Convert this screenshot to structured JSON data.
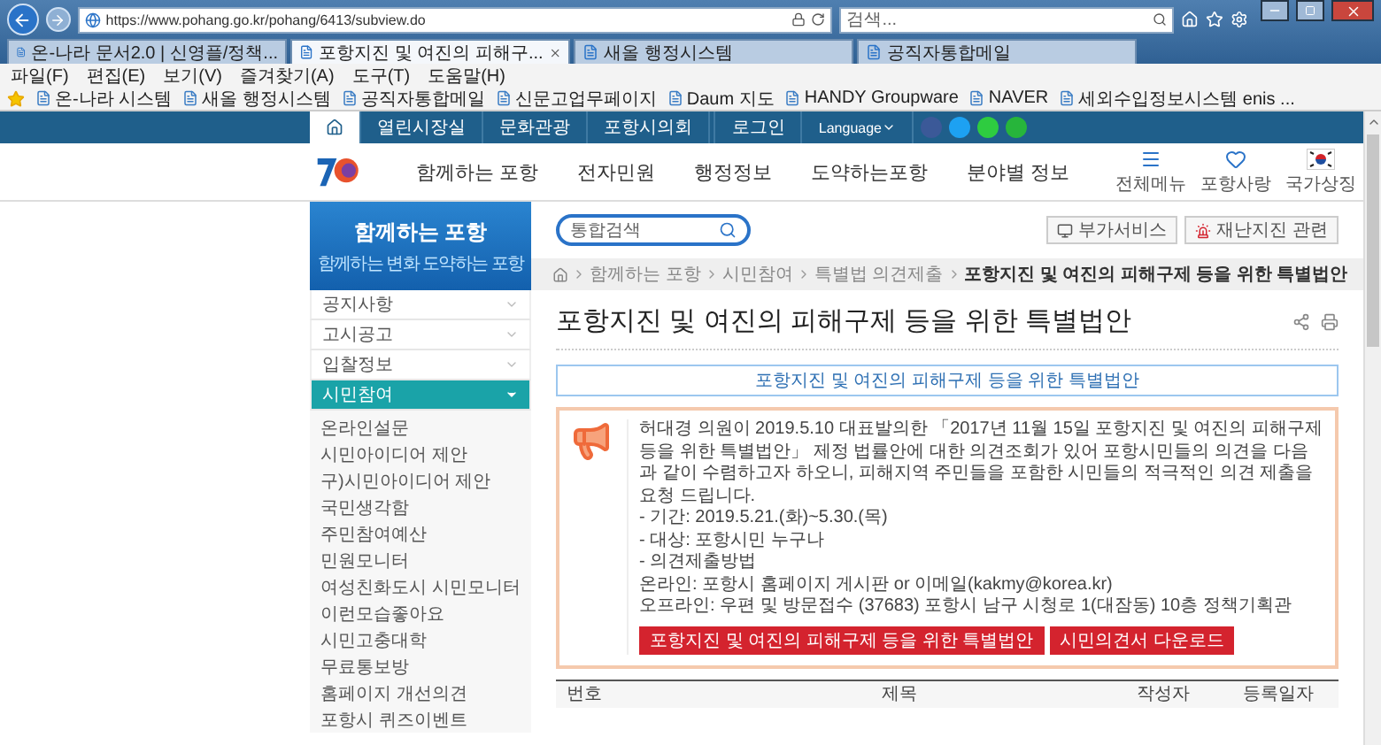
{
  "browser": {
    "address": "https://www.pohang.go.kr/pohang/6413/subview.do",
    "search": {
      "placeholder": "검색..."
    },
    "tabs": [
      {
        "label": "온-나라 문서2.0 | 신영플/정책...",
        "selected": false
      },
      {
        "label": "포항지진 및 여진의 피해구...",
        "selected": true
      },
      {
        "label": "새올 행정시스템",
        "selected": false
      },
      {
        "label": "공직자통합메일",
        "selected": false
      }
    ],
    "menu": [
      "파일(F)",
      "편집(E)",
      "보기(V)",
      "즐겨찾기(A)",
      "도구(T)",
      "도움말(H)"
    ],
    "favorites": [
      "온-나라 시스템",
      "새올 행정시스템",
      "공직자통합메일",
      "신문고업무페이지",
      "Daum 지도",
      "HANDY Groupware",
      "NAVER",
      "세외수입정보시스템 enis ..."
    ]
  },
  "topbar": {
    "items": [
      {
        "kind": "home",
        "selected": true
      },
      {
        "kind": "link",
        "label": "열린시장실",
        "selected": false
      },
      {
        "kind": "link",
        "label": "문화관광",
        "selected": false
      },
      {
        "kind": "link",
        "label": "포항시의회",
        "selected": false
      }
    ],
    "login": "로그인",
    "language": "Language"
  },
  "header": {
    "nav": [
      "함께하는 포항",
      "전자민원",
      "행정정보",
      "도약하는포항",
      "분야별 정보"
    ],
    "tools": [
      "전체메뉴",
      "포항사랑",
      "국가상징"
    ]
  },
  "banner": {
    "title": "함께하는 포항",
    "subtitle": "함께하는 변화 도약하는 포항"
  },
  "search": {
    "placeholder": "통합검색"
  },
  "quick_buttons": [
    "부가서비스",
    "재난지진 관련"
  ],
  "breadcrumb": [
    "함께하는 포항",
    "시민참여",
    "특별법 의견제출",
    "포항지진 및 여진의 피해구제 등을 위한 특별법안"
  ],
  "sidebar": {
    "items": [
      {
        "label": "공지사항",
        "expanded": false
      },
      {
        "label": "고시공고",
        "expanded": false
      },
      {
        "label": "입찰정보",
        "expanded": false
      },
      {
        "label": "시민참여",
        "expanded": true,
        "children": [
          {
            "label": "온라인설문"
          },
          {
            "label": "시민아이디어 제안"
          },
          {
            "label": "구)시민아이디어 제안"
          },
          {
            "label": "국민생각함"
          },
          {
            "label": "주민참여예산"
          },
          {
            "label": "민원모니터"
          },
          {
            "label": "여성친화도시 시민모니터"
          },
          {
            "label": "이런모습좋아요"
          },
          {
            "label": "시민고충대학"
          },
          {
            "label": "무료통보방"
          },
          {
            "label": "홈페이지 개선의견"
          },
          {
            "label": "포항시 퀴즈이벤트"
          }
        ]
      }
    ]
  },
  "content": {
    "title": "포항지진 및 여진의 피해구제 등을 위한 특별법안",
    "link_box": "포항지진 및 여진의 피해구제 등을 위한 특별법안",
    "notice": {
      "paragraph": "허대경 의원이 2019.5.10 대표발의한 「2017년 11월 15일 포항지진 및 여진의 피해구제 등을 위한 특별법안」 제정 법률안에 대한 의견조회가 있어 포항시민들의 의견을 다음과 같이 수렴하고자 하오니, 피해지역 주민들을 포함한 시민들의 적극적인 의견 제출을 요청 드립니다.",
      "lines": [
        "- 기간: 2019.5.21.(화)~5.30.(목)",
        "- 대상: 포항시민 누구나",
        "- 의견제출방법",
        "온라인: 포항시 홈페이지 게시판 or 이메일(kakmy@korea.kr)",
        "오프라인: 우편 및 방문접수 (37683) 포항시 남구 시청로 1(대잠동) 10층 정책기획관"
      ],
      "buttons": [
        "포항지진 및 여진의 피해구제 등을 위한 특별법안",
        "시민의견서 다운로드"
      ]
    },
    "table": {
      "columns": [
        "번호",
        "제목",
        "작성자",
        "등록일자"
      ]
    }
  }
}
